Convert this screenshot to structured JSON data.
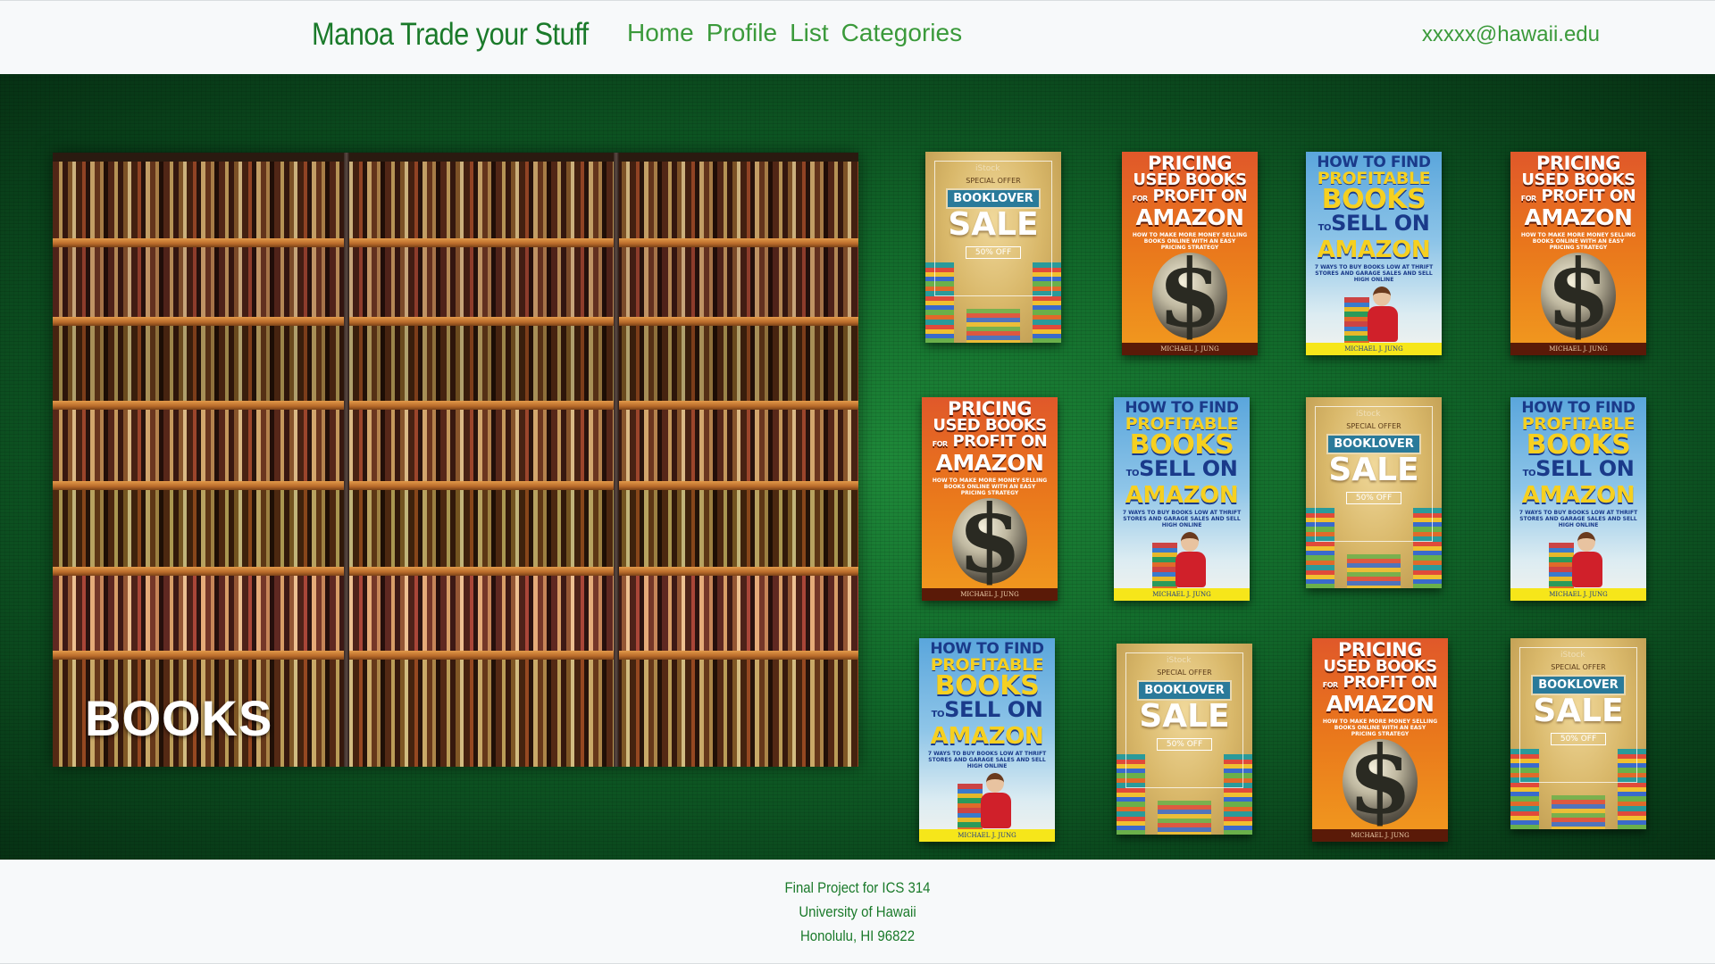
{
  "navbar": {
    "brand": "Manoa Trade your Stuff",
    "links": [
      "Home",
      "Profile",
      "List",
      "Categories"
    ],
    "user_email": "xxxxx@hawaii.edu"
  },
  "hero": {
    "feature_label": "BOOKS",
    "covers": {
      "pricing": {
        "line1": "PRICING",
        "line2": "USED BOOKS",
        "line3_small": "FOR",
        "line3": "PROFIT ON",
        "line4": "AMAZON",
        "subtitle": "HOW TO MAKE MORE MONEY SELLING BOOKS ONLINE WITH AN EASY PRICING STRATEGY",
        "author": "MICHAEL J. JUNG"
      },
      "howto": {
        "line1": "HOW TO FIND",
        "line2": "PROFITABLE",
        "line3": "BOOKS",
        "line4_small": "TO",
        "line4": "SELL ON",
        "line5": "AMAZON",
        "subtitle": "7 WAYS TO BUY BOOKS LOW AT THRIFT STORES AND GARAGE SALES AND SELL HIGH ONLINE",
        "author": "MICHAEL J. JUNG"
      },
      "sale": {
        "special": "SPECIAL OFFER",
        "booklover": "BOOKLOVER",
        "sale": "SALE",
        "off": "50% OFF",
        "watermark": "iStock"
      }
    }
  },
  "footer": {
    "lines": [
      "Final Project for ICS 314",
      "University of Hawaii",
      "Honolulu, HI 96822"
    ]
  },
  "colors": {
    "brand_green": "#1a7a2a",
    "link_green": "#3b9a3b",
    "hero_green": "#126a2b"
  }
}
